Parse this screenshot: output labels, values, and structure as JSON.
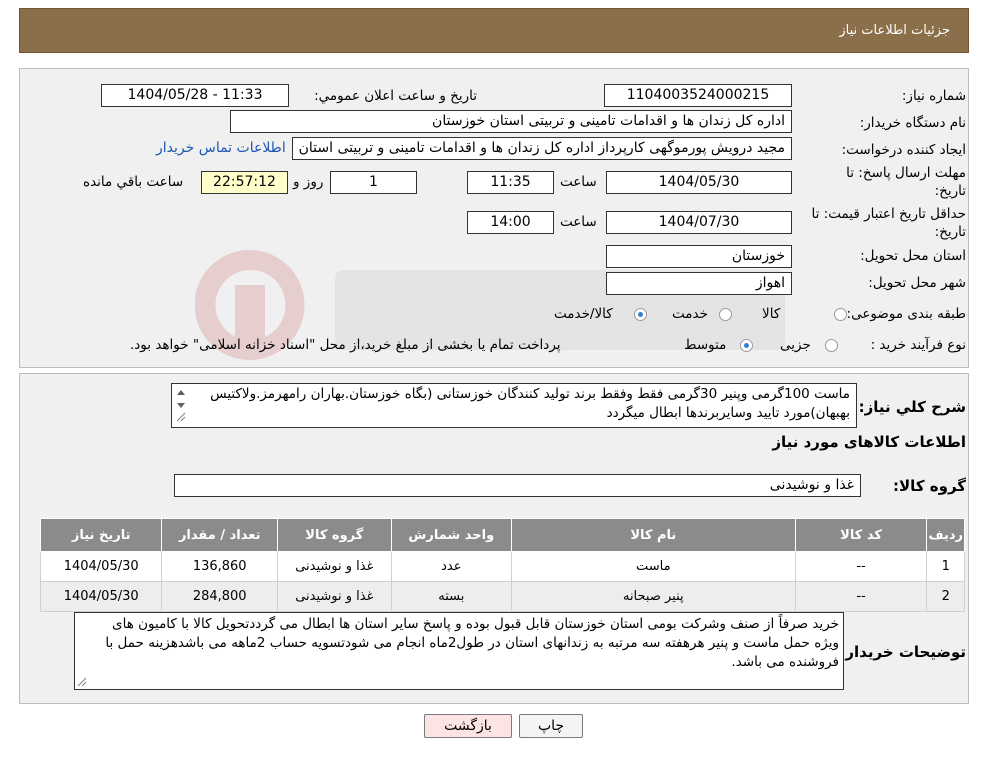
{
  "header": {
    "title": "جزئیات اطلاعات نیاز"
  },
  "fields": {
    "need_number_label": "شماره نیاز:",
    "need_number": "1104003524000215",
    "announce_label": "تاریخ و ساعت اعلان عمومي:",
    "announce_value": "1404/05/28 - 11:33",
    "buyer_org_label": "نام دستگاه خریدار:",
    "buyer_org": "اداره كل زندان ها و اقدامات تامینی و تربیتی استان خوزستان",
    "creator_label": "ایجاد کننده درخواست:",
    "creator": "مجید درویش پورموگهی کارپرداز اداره كل زندان ها و اقدامات تامینی و تربیتی استان",
    "contact_link": "اطلاعات تماس خریدار",
    "deadline_label_1": "مهلت ارسال پاسخ: تا",
    "deadline_label_2": "تاریخ:",
    "deadline_date": "1404/05/30",
    "time_label": "ساعت",
    "deadline_time": "11:35",
    "days_value": "1",
    "days_label": "روز و",
    "remaining_value": "22:57:12",
    "remaining_label": "ساعت باقي مانده",
    "validity_label_1": "حداقل تاریخ اعتبار قیمت: تا",
    "validity_label_2": "تاریخ:",
    "validity_date": "1404/07/30",
    "validity_time": "14:00",
    "province_label": "استان محل تحویل:",
    "province": "خوزستان",
    "city_label": "شهر محل تحویل:",
    "city": "اهواز",
    "category_label": "طبقه بندی موضوعی:",
    "category_options": [
      "کالا",
      "خدمت",
      "کالا/خدمت"
    ],
    "purchase_label": "نوع فرآیند خرید :",
    "purchase_options": [
      "جزیی",
      "متوسط"
    ],
    "purchase_note": "پرداخت تمام یا بخشی از مبلغ خرید،از محل \"اسناد خزانه اسلامی\" خواهد بود."
  },
  "summary": {
    "label": "شرح كلي نياز:",
    "text": "ماست 100گرمی وپنیر 30گرمی فقط وفقط برند تولید کنندگان خوزستانی (بگاه خوزستان.بهاران رامهرمز.ولاکتیس بهبهان)مورد تایید وسایربرندها ابطال میگردد",
    "goods_info_title": "اطلاعات کالاهای مورد نیاز",
    "goods_group_label": "گروه کالا:",
    "goods_group": "غذا و نوشیدنی"
  },
  "table": {
    "headers": [
      "ردیف",
      "کد کالا",
      "نام کالا",
      "واحد شمارش",
      "گروه کالا",
      "تعداد / مقدار",
      "تاریخ نیاز"
    ],
    "rows": [
      [
        "1",
        "--",
        "ماست",
        "عدد",
        "غذا و نوشیدنی",
        "136,860",
        "1404/05/30"
      ],
      [
        "2",
        "--",
        "پنیر صبحانه",
        "بسته",
        "غذا و نوشیدنی",
        "284,800",
        "1404/05/30"
      ]
    ]
  },
  "buyer_notes": {
    "label": "توضیحات خریدار:",
    "text": "خرید صرفاً از صنف وشرکت بومی استان خوزستان قابل قبول بوده و پاسخ سایر استان ها ابطال می گرددتحویل کالا با کامیون های ویژه حمل ماست و پنیر هرهفته سه مرتبه به زندانهای استان در طول2ماه انجام می شودتسویه حساب 2ماهه می باشدهزینه حمل با فروشنده می باشد."
  },
  "buttons": {
    "print": "چاپ",
    "back": "بازگشت"
  },
  "colors": {
    "header_bg": "#8b6f4a",
    "panel_bg": "#f0f0f0",
    "table_header": "#8b8b8b",
    "back_btn": "#fde4e4"
  }
}
